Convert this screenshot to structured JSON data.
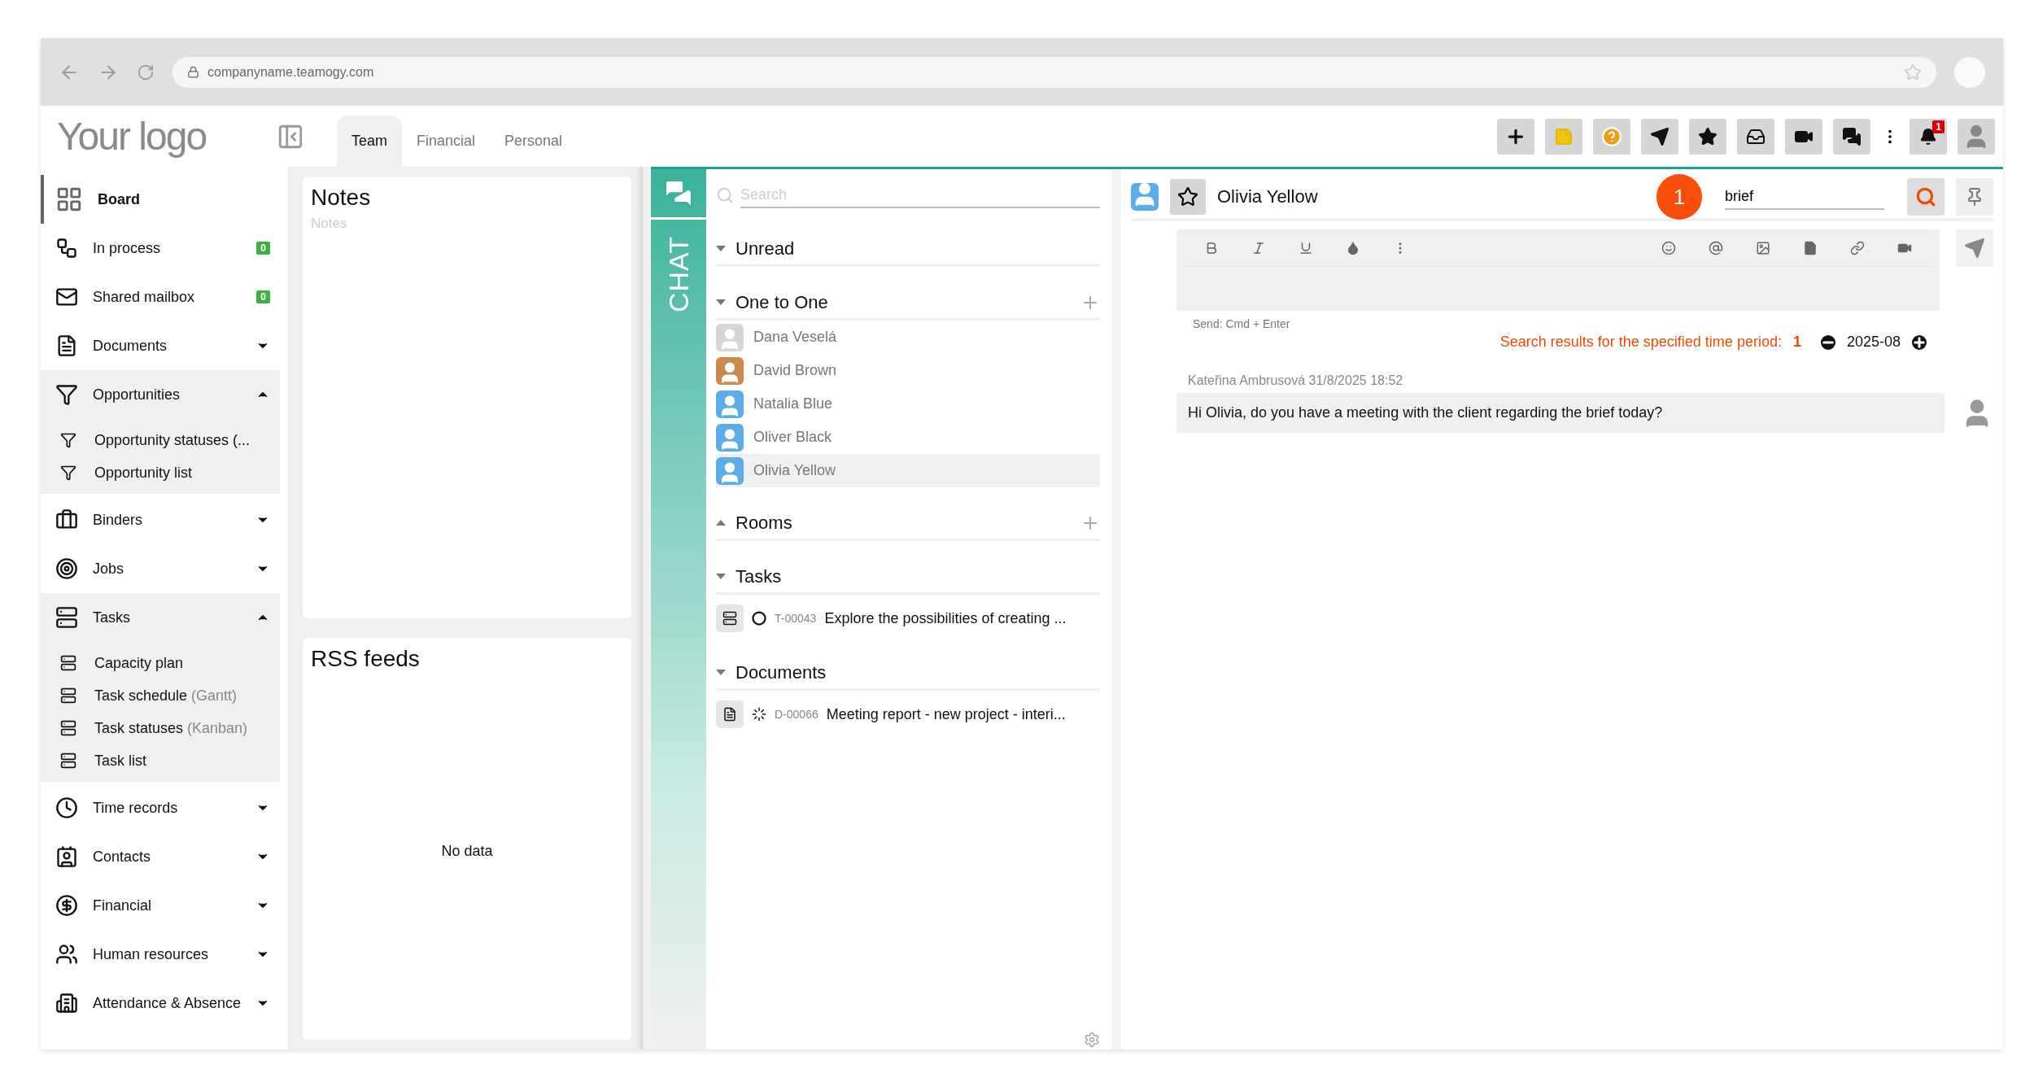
{
  "browser": {
    "url": "companyname.teamogy.com"
  },
  "header": {
    "logo": "Your logo",
    "tabs": [
      {
        "label": "Team",
        "selected": true
      },
      {
        "label": "Financial",
        "selected": false
      },
      {
        "label": "Personal",
        "selected": false
      }
    ],
    "notification_count": "1"
  },
  "sidebar": {
    "items": [
      {
        "label": "Board",
        "selected": true
      },
      {
        "label": "In process",
        "badge": "0",
        "selected": false
      },
      {
        "label": "Shared mailbox",
        "badge": "0",
        "selected": false
      },
      {
        "label": "Documents",
        "expanded": false,
        "selected": false
      },
      {
        "label": "Opportunities",
        "expanded": true,
        "selected": false,
        "children": [
          {
            "label": "Opportunity statuses (..."
          },
          {
            "label": "Opportunity list"
          }
        ]
      },
      {
        "label": "Binders",
        "expanded": false,
        "selected": false
      },
      {
        "label": "Jobs",
        "expanded": false,
        "selected": false
      },
      {
        "label": "Tasks",
        "expanded": true,
        "selected": false,
        "children": [
          {
            "label": "Capacity plan"
          },
          {
            "label": "Task schedule",
            "note": "(Gantt)"
          },
          {
            "label": "Task statuses",
            "note": "(Kanban)"
          },
          {
            "label": "Task list"
          }
        ]
      },
      {
        "label": "Time records",
        "expanded": false,
        "selected": false
      },
      {
        "label": "Contacts",
        "expanded": false,
        "selected": false
      },
      {
        "label": "Financial",
        "expanded": false,
        "selected": false
      },
      {
        "label": "Human resources",
        "expanded": false,
        "selected": false
      },
      {
        "label": "Attendance & Absence",
        "expanded": false,
        "selected": false
      }
    ]
  },
  "notes": {
    "title": "Notes",
    "placeholder": "Notes"
  },
  "rss": {
    "title": "RSS feeds",
    "empty": "No data"
  },
  "chat": {
    "label": "CHAT",
    "search_placeholder": "Search",
    "sections": [
      {
        "title": "Unread",
        "expanded": true,
        "can_add": false
      },
      {
        "title": "One to One",
        "expanded": true,
        "can_add": true,
        "contacts": [
          {
            "name": "Dana Veselá",
            "selected": false
          },
          {
            "name": "David Brown",
            "selected": false
          },
          {
            "name": "Natalia Blue",
            "selected": false
          },
          {
            "name": "Oliver Black",
            "selected": false
          },
          {
            "name": "Olivia Yellow",
            "selected": true
          }
        ]
      },
      {
        "title": "Rooms",
        "expanded": false,
        "can_add": true
      },
      {
        "title": "Tasks",
        "expanded": true,
        "can_add": false,
        "records": [
          {
            "kind": "task",
            "code": "T-00043",
            "title": "Explore the possibilities of creating ..."
          }
        ]
      },
      {
        "title": "Documents",
        "expanded": true,
        "can_add": false,
        "records": [
          {
            "kind": "document",
            "code": "D-00066",
            "title": "Meeting report - new project - interi..."
          }
        ]
      }
    ]
  },
  "conversation": {
    "contact": "Olivia Yellow",
    "match_count": "1",
    "search_value": "brief",
    "send_hint": "Send: Cmd + Enter",
    "results_label": "Search results for the specified time period:",
    "results_count": "1",
    "period": "2025-08",
    "messages": [
      {
        "meta": "Kateřina Ambrusová 31/8/2025 18:52",
        "text": "Hi Olivia, do you have a meeting with the client regarding the brief today?"
      }
    ]
  }
}
